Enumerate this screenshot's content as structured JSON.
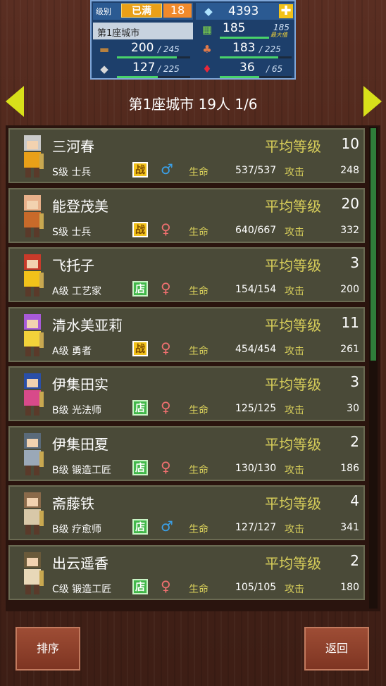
{
  "hud": {
    "rank_label": "级别",
    "rank_status": "已满",
    "rank_value": "18",
    "gems": "4393",
    "plus": "✚",
    "city_name": "第1座城市",
    "resources": [
      {
        "icon": "grass-icon",
        "glyph": "▦",
        "value": "185",
        "max": "185",
        "fill": 1.0,
        "note": "最大值"
      },
      {
        "icon": "wood-icon",
        "glyph": "▬",
        "value": "200",
        "max": "245",
        "fill": 0.82
      },
      {
        "icon": "food-icon",
        "glyph": "♣",
        "value": "183",
        "max": "225",
        "fill": 0.81
      },
      {
        "icon": "stone-icon",
        "glyph": "◆",
        "value": "127",
        "max": "225",
        "fill": 0.56
      },
      {
        "icon": "ruby-icon",
        "glyph": "♦",
        "value": "36",
        "max": "65",
        "fill": 0.55
      }
    ]
  },
  "header": {
    "title": "第1座城市  19人 1/6"
  },
  "labels": {
    "avg_level": "平均等级",
    "hp": "生命",
    "atk": "攻击",
    "fight_badge": "战",
    "shop_badge": "店"
  },
  "residents": [
    {
      "name": "三河春",
      "avg_level": "10",
      "grade": "S级 士兵",
      "badge": "fight",
      "gender": "male",
      "hp": "537/537",
      "atk": "248"
    },
    {
      "name": "能登茂美",
      "avg_level": "20",
      "grade": "S级 士兵",
      "badge": "fight",
      "gender": "female",
      "hp": "640/667",
      "atk": "332"
    },
    {
      "name": "飞托子",
      "avg_level": "3",
      "grade": "A级 工艺家",
      "badge": "shop",
      "gender": "female",
      "hp": "154/154",
      "atk": "200"
    },
    {
      "name": "清水美亚莉",
      "avg_level": "11",
      "grade": "A级 勇者",
      "badge": "fight",
      "gender": "female",
      "hp": "454/454",
      "atk": "261"
    },
    {
      "name": "伊集田实",
      "avg_level": "3",
      "grade": "B级 光法师",
      "badge": "shop",
      "gender": "female",
      "hp": "125/125",
      "atk": "30"
    },
    {
      "name": "伊集田夏",
      "avg_level": "2",
      "grade": "B级 锻造工匠",
      "badge": "shop",
      "gender": "female",
      "hp": "130/130",
      "atk": "186"
    },
    {
      "name": "斋藤铁",
      "avg_level": "4",
      "grade": "B级 疗愈师",
      "badge": "shop",
      "gender": "male",
      "hp": "127/127",
      "atk": "341"
    },
    {
      "name": "出云遥香",
      "avg_level": "2",
      "grade": "C级 锻造工匠",
      "badge": "shop",
      "gender": "female",
      "hp": "105/105",
      "atk": "180"
    }
  ],
  "buttons": {
    "sort": "排序",
    "back": "返回"
  },
  "colors": {
    "gold_label": "#d8cf5a",
    "card_bg": "#4a4a38",
    "arrow": "#d8e01a",
    "hud_bg": "#1d3f6b"
  }
}
